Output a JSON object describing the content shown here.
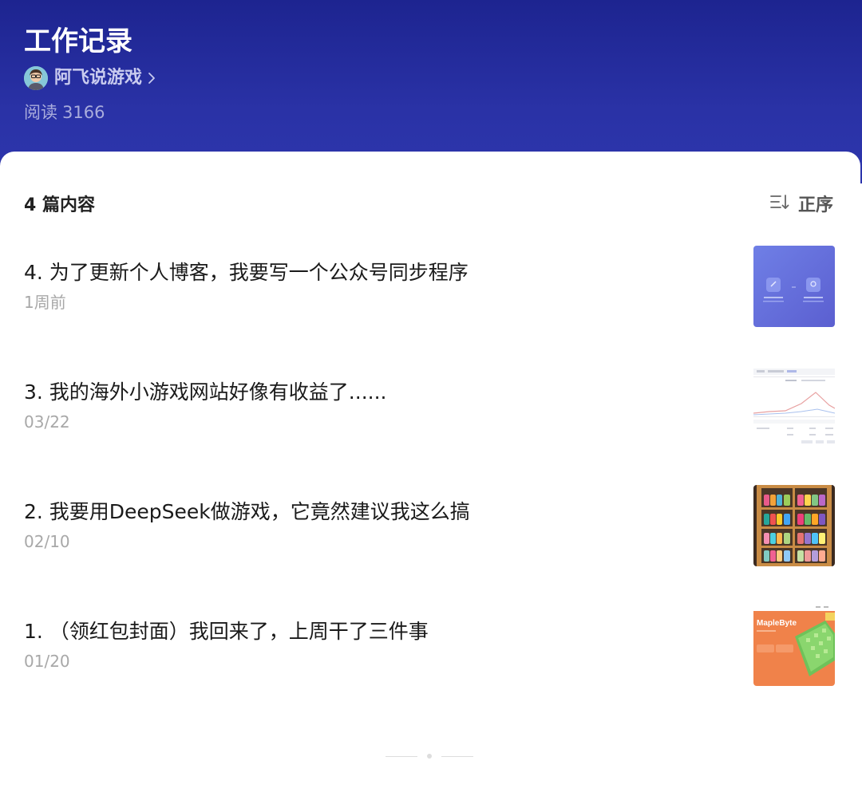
{
  "header": {
    "title": "工作记录",
    "author_name": "阿飞说游戏",
    "read_label": "阅读",
    "read_count": "3166"
  },
  "list": {
    "count_label": "4 篇内容",
    "sort_label": "正序",
    "items": [
      {
        "title": "4. 为了更新个人博客，我要写一个公众号同步程序",
        "date": "1周前",
        "thumb": "gradient-ui-screenshot"
      },
      {
        "title": "3. 我的海外小游戏网站好像有收益了......",
        "date": "03/22",
        "thumb": "analytics-chart-screenshot"
      },
      {
        "title": "2. 我要用DeepSeek做游戏，它竟然建议我这么搞",
        "date": "02/10",
        "thumb": "shoe-shelf-photo"
      },
      {
        "title": "1. （领红包封面）我回来了，上周干了三件事",
        "date": "01/20",
        "thumb": "maplebyte-orange-banner"
      }
    ],
    "thumb_texts": {
      "maplebyte": "MapleByte"
    }
  },
  "colors": {
    "header_top": "#1d2490",
    "header_bottom": "#2d36ad",
    "title_text": "#1a1a1a",
    "date_text": "#a8a8a8"
  }
}
